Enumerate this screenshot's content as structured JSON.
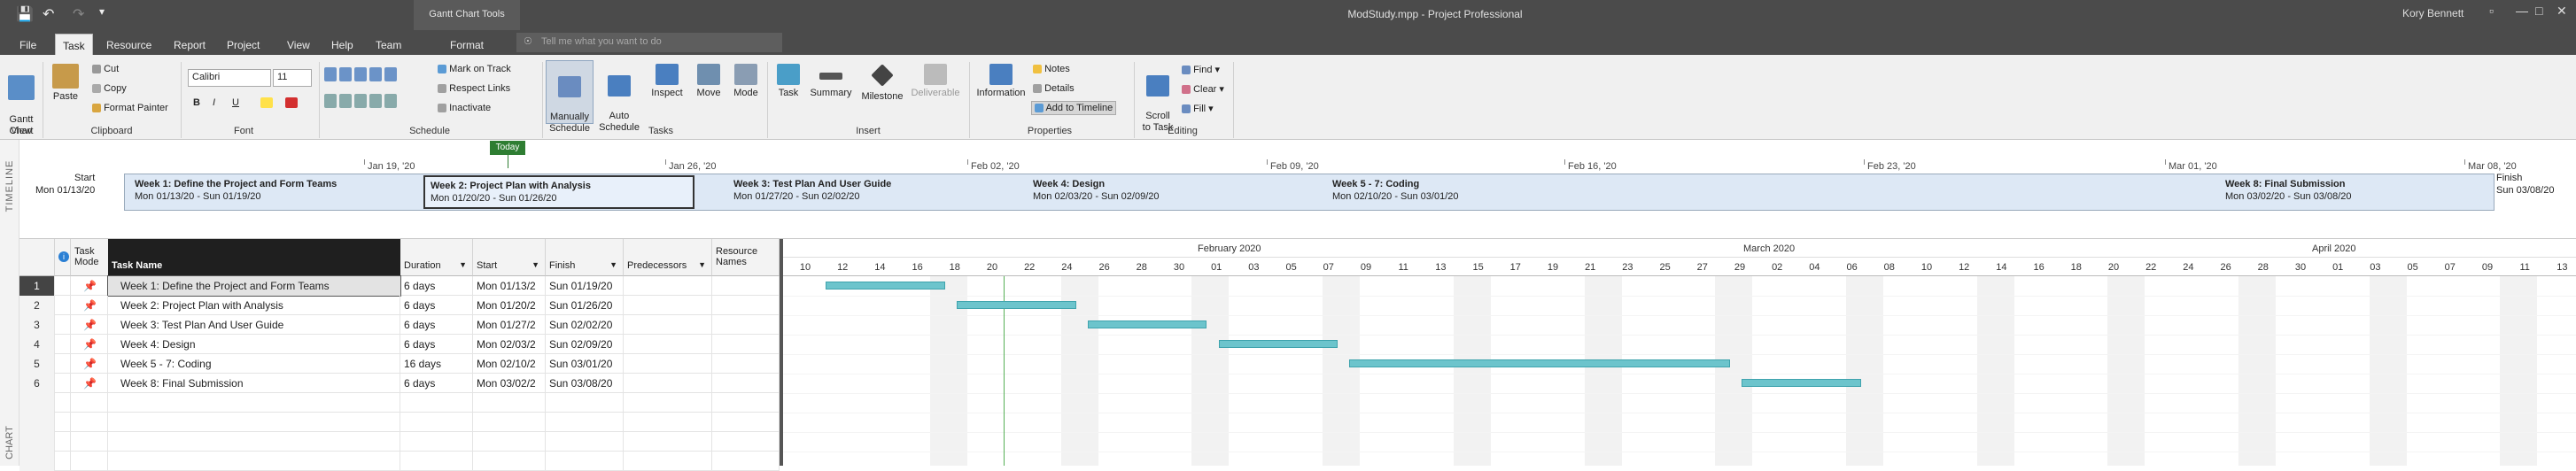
{
  "app": {
    "title": "ModStudy.mpp - Project Professional",
    "contextual_header": "Gantt Chart Tools",
    "user": "Kory Bennett",
    "tell_me_placeholder": "Tell me what you want to do"
  },
  "tabs": [
    "File",
    "Task",
    "Resource",
    "Report",
    "Project",
    "View",
    "Help",
    "Team",
    "Format"
  ],
  "active_tab": "Task",
  "ribbon": {
    "view_group": {
      "label": "View",
      "gantt": "Gantt\nChart"
    },
    "clipboard": {
      "label": "Clipboard",
      "paste": "Paste",
      "cut": "Cut",
      "copy": "Copy",
      "format_painter": "Format Painter"
    },
    "font": {
      "label": "Font",
      "family": "Calibri",
      "size": "11",
      "bold": "B",
      "italic": "I",
      "underline": "U"
    },
    "schedule": {
      "label": "Schedule",
      "mark_on_track": "Mark on Track",
      "respect_links": "Respect Links",
      "inactivate": "Inactivate"
    },
    "tasks": {
      "label": "Tasks",
      "manually": "Manually\nSchedule",
      "auto": "Auto\nSchedule",
      "inspect": "Inspect",
      "move": "Move",
      "mode": "Mode"
    },
    "insert": {
      "label": "Insert",
      "task": "Task",
      "summary": "Summary",
      "milestone": "Milestone",
      "deliverable": "Deliverable"
    },
    "properties": {
      "label": "Properties",
      "information": "Information",
      "notes": "Notes",
      "details": "Details",
      "add_to_timeline": "Add to Timeline"
    },
    "editing": {
      "label": "Editing",
      "scroll": "Scroll\nto Task",
      "find": "Find",
      "clear": "Clear",
      "fill": "Fill"
    }
  },
  "timeline": {
    "side_label": "TIMELINE",
    "today_label": "Today",
    "start_label": "Start",
    "start_date": "Mon 01/13/20",
    "finish_label": "Finish",
    "finish_date": "Sun 03/08/20",
    "dates": [
      "Jan 19, '20",
      "Jan 26, '20",
      "Feb 02, '20",
      "Feb 09, '20",
      "Feb 16, '20",
      "Feb 23, '20",
      "Mar 01, '20",
      "Mar 08, '20"
    ],
    "items": [
      {
        "name": "Week 1: Define the Project and Form Teams",
        "range": "Mon 01/13/20 - Sun 01/19/20"
      },
      {
        "name": "Week 2: Project Plan with Analysis",
        "range": "Mon 01/20/20 - Sun 01/26/20"
      },
      {
        "name": "Week 3: Test Plan And User Guide",
        "range": "Mon 01/27/20 - Sun 02/02/20"
      },
      {
        "name": "Week 4: Design",
        "range": "Mon 02/03/20 - Sun 02/09/20"
      },
      {
        "name": "Week 5 - 7: Coding",
        "range": "Mon 02/10/20 - Sun 03/01/20"
      },
      {
        "name": "Week 8: Final Submission",
        "range": "Mon 03/02/20 - Sun 03/08/20"
      }
    ]
  },
  "grid": {
    "side_label": "CHART",
    "headers": {
      "task_mode": "Task\nMode",
      "task_name": "Task Name",
      "duration": "Duration",
      "start": "Start",
      "finish": "Finish",
      "predecessors": "Predecessors",
      "resource_names": "Resource\nNames"
    },
    "rows": [
      {
        "id": "1",
        "name": "Week 1: Define the Project and Form Teams",
        "duration": "6 days",
        "start": "Mon 01/13/2",
        "finish": "Sun 01/19/20",
        "predecessors": ""
      },
      {
        "id": "2",
        "name": "Week 2: Project Plan with Analysis",
        "duration": "6 days",
        "start": "Mon 01/20/2",
        "finish": "Sun 01/26/20",
        "predecessors": ""
      },
      {
        "id": "3",
        "name": "Week 3: Test Plan And User Guide",
        "duration": "6 days",
        "start": "Mon 01/27/2",
        "finish": "Sun 02/02/20",
        "predecessors": ""
      },
      {
        "id": "4",
        "name": "Week 4: Design",
        "duration": "6 days",
        "start": "Mon 02/03/2",
        "finish": "Sun 02/09/20",
        "predecessors": ""
      },
      {
        "id": "5",
        "name": "Week 5 - 7: Coding",
        "duration": "16 days",
        "start": "Mon 02/10/2",
        "finish": "Sun 03/01/20",
        "predecessors": ""
      },
      {
        "id": "6",
        "name": "Week 8: Final Submission",
        "duration": "6 days",
        "start": "Mon 03/02/2",
        "finish": "Sun 03/08/20",
        "predecessors": ""
      }
    ]
  },
  "gantt": {
    "months": [
      "February 2020",
      "March 2020",
      "April 2020"
    ],
    "days": [
      "10",
      "12",
      "14",
      "16",
      "18",
      "20",
      "22",
      "24",
      "26",
      "28",
      "30",
      "01",
      "03",
      "05",
      "07",
      "09",
      "11",
      "13",
      "15",
      "17",
      "19",
      "21",
      "23",
      "25",
      "27",
      "29",
      "02",
      "04",
      "06",
      "08",
      "10",
      "12",
      "14",
      "16",
      "18",
      "20",
      "22",
      "24",
      "26",
      "28",
      "30",
      "01",
      "03",
      "05",
      "07",
      "09",
      "11",
      "13"
    ],
    "bar_color": "#6cc4cc",
    "bars": [
      {
        "start": "01/13/20",
        "finish": "01/19/20"
      },
      {
        "start": "01/20/20",
        "finish": "01/26/20"
      },
      {
        "start": "01/27/20",
        "finish": "02/02/20"
      },
      {
        "start": "02/03/20",
        "finish": "02/09/20"
      },
      {
        "start": "02/10/20",
        "finish": "03/01/20"
      },
      {
        "start": "03/02/20",
        "finish": "03/08/20"
      }
    ]
  }
}
